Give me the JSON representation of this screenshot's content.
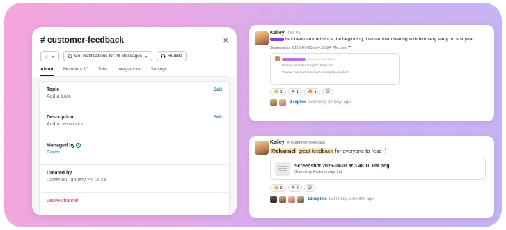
{
  "panel": {
    "title": "# customer-feedback",
    "close_glyph": "×",
    "star_glyph": "☆",
    "notif_label": "Get Notifications for All Messages",
    "huddle_label": "Huddle",
    "tabs": [
      "About",
      "Members 10",
      "Tabs",
      "Integrations",
      "Settings"
    ],
    "topic_label": "Topic",
    "topic_value": "Add a topic",
    "description_label": "Description",
    "description_value": "Add a description",
    "managed_label": "Managed by",
    "managed_value": "Carter",
    "created_label": "Created by",
    "created_value": "Carter on January 26, 2024",
    "edit_label": "Edit",
    "leave_label": "Leave channel"
  },
  "message1": {
    "name": "Kailey",
    "time": "4:56 PM",
    "text": "has been around since the beginning, I remember chatting with him very early on last year",
    "file": "Screenshot 2025-07-25 at 4.55.24 PM.png",
    "preview_time": "Yesterday at 10:36 PM",
    "preview_line1": "Not sure what else to say but thank you",
    "preview_line2": "You and your team have been nothing but excellent",
    "reactions": [
      {
        "emoji": "👏",
        "count": "1"
      },
      {
        "emoji": "❤",
        "count": "1"
      },
      {
        "emoji": "🔥",
        "count": "1"
      }
    ],
    "add_reaction": "☺",
    "replies": "2 replies",
    "last_reply": "Last reply 24 days ago"
  },
  "message2": {
    "name": "Kailey",
    "channel": "# customer-feedback",
    "mention": "@channel",
    "highlight": "great feedback",
    "text_rest": " for everyone to read :)",
    "file_name": "Screenshot 2025-04-03 at 3.48.10 PM.png",
    "file_sub": "Shared by Kailey on Apr 3rd",
    "reactions": [
      {
        "emoji": "👏",
        "count": "2"
      },
      {
        "emoji": "❤",
        "count": "2"
      }
    ],
    "add_reaction": "☺",
    "replies": "12 replies",
    "last_reply": "Last reply 5 months ago"
  },
  "colors": {
    "accent_link": "#1264a3",
    "danger": "#e01e5a",
    "mention_bg": "#fbe7b5"
  }
}
